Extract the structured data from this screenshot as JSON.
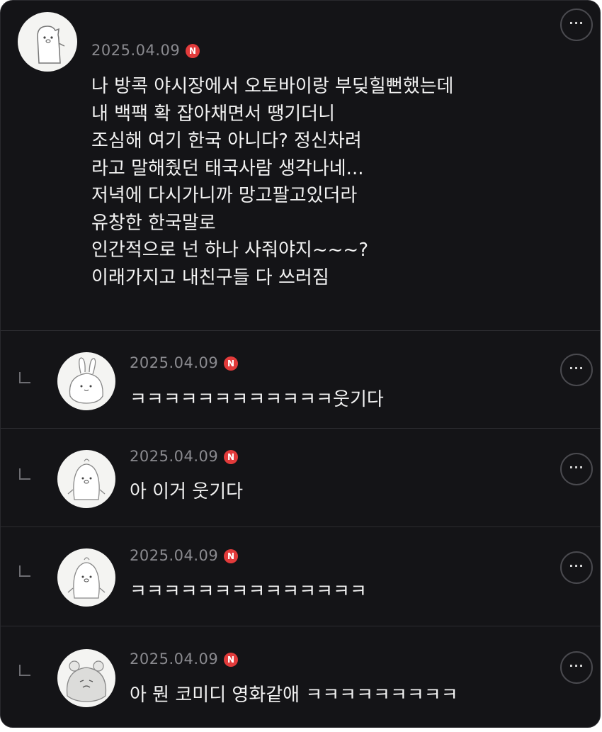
{
  "main_comment": {
    "date": "2025.04.09",
    "badge": "N",
    "text": "나 방콕 야시장에서 오토바이랑 부딪힐뻔했는데\n내 백팩 확 잡아채면서 땡기더니\n조심해 여기 한국 아니다? 정신차려\n라고 말해줬던 태국사람 생각나네...\n저녁에 다시가니까 망고팔고있더라\n유창한 한국말로\n인간적으로 넌 하나 사줘야지~~~?\n이래가지고 내친구들 다 쓰러짐",
    "more_label": "···",
    "avatar_icon": "bear-avatar-icon"
  },
  "replies": [
    {
      "date": "2025.04.09",
      "badge": "N",
      "text": "ㅋㅋㅋㅋㅋㅋㅋㅋㅋㅋㅋㅋ웃기다",
      "more_label": "···",
      "avatar_icon": "rabbit-avatar-icon"
    },
    {
      "date": "2025.04.09",
      "badge": "N",
      "text": "아 이거 웃기다",
      "more_label": "···",
      "avatar_icon": "penguin-avatar-icon"
    },
    {
      "date": "2025.04.09",
      "badge": "N",
      "text": "ㅋㅋㅋㅋㅋㅋㅋㅋㅋㅋㅋㅋㅋㅋ",
      "more_label": "···",
      "avatar_icon": "penguin-avatar-icon"
    },
    {
      "date": "2025.04.09",
      "badge": "N",
      "text": "아 뭔 코미디 영화같애 ㅋㅋㅋㅋㅋㅋㅋㅋㅋ",
      "more_label": "···",
      "avatar_icon": "hamster-avatar-icon"
    }
  ],
  "colors": {
    "background": "#141417",
    "badge": "#e23b3b",
    "date": "#8a8a8f",
    "text": "#f2f2f2"
  }
}
